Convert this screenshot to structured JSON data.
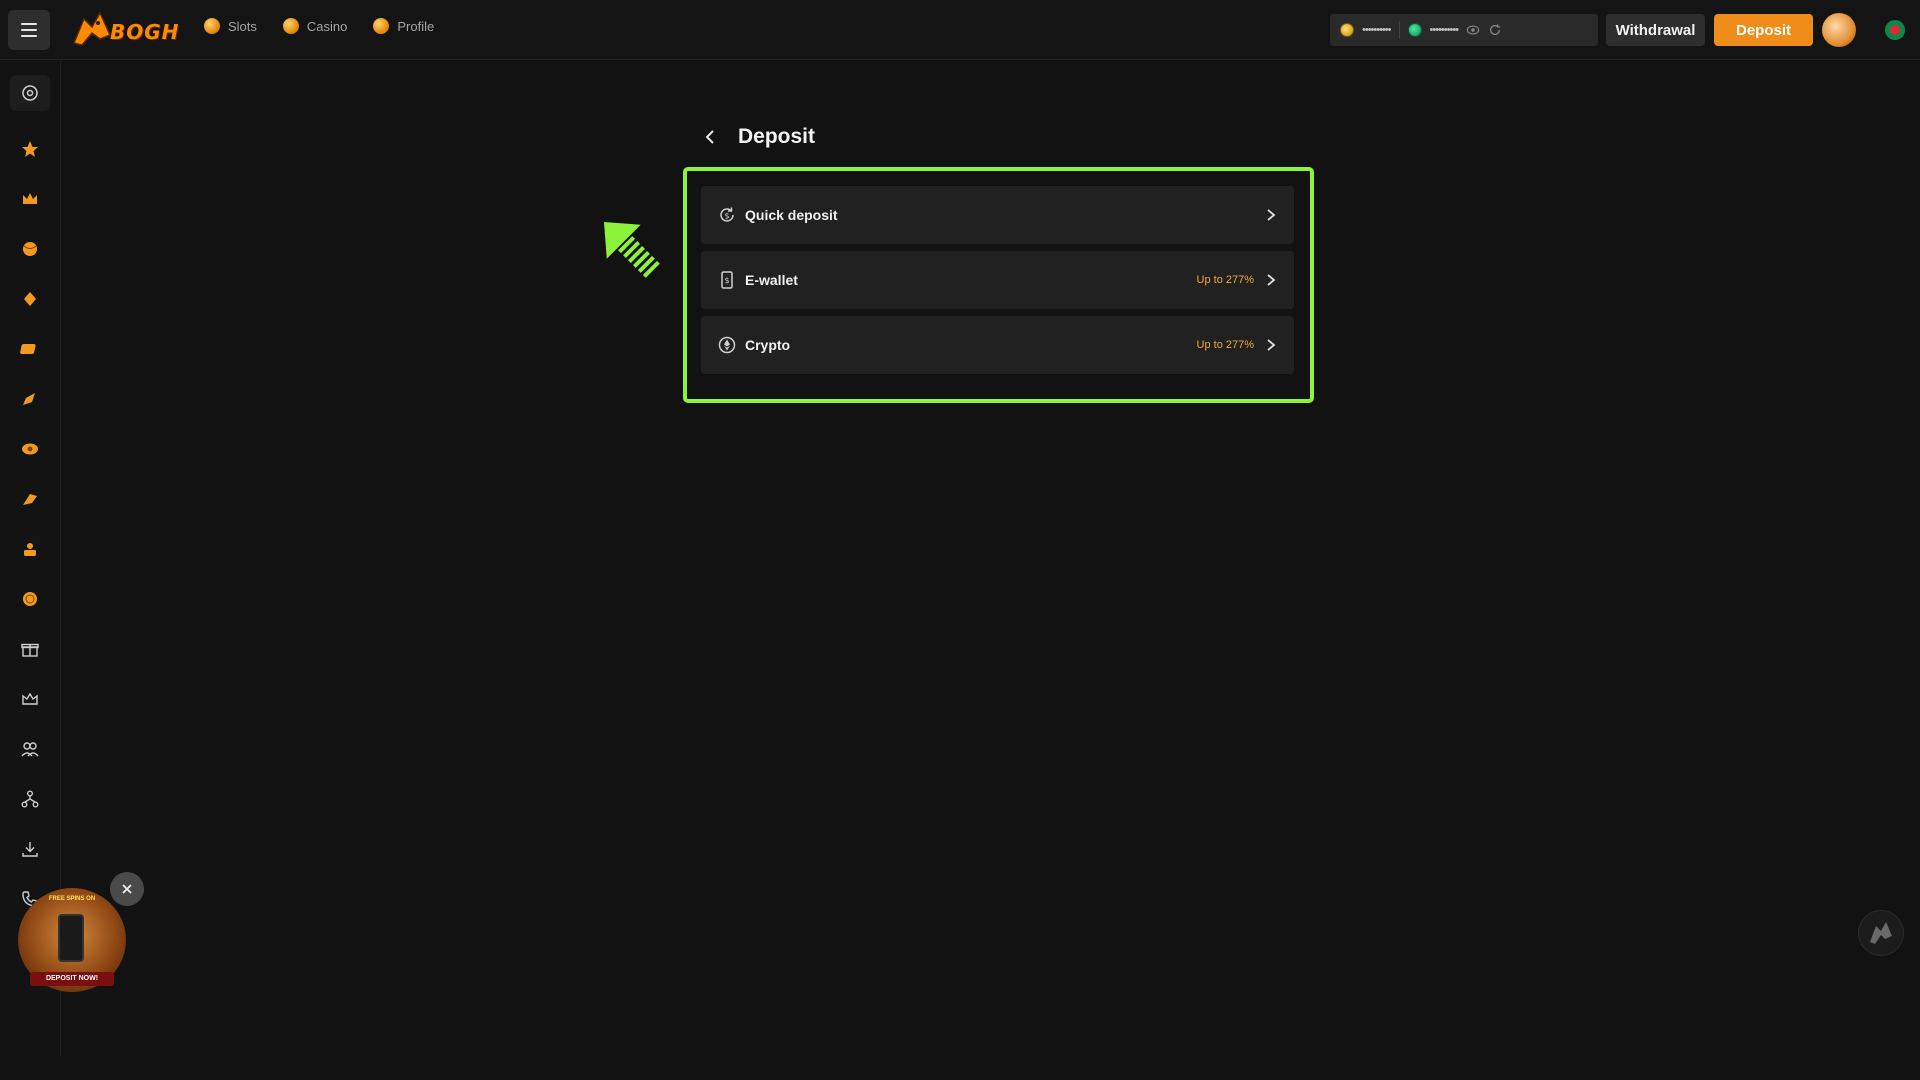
{
  "header": {
    "logo_text": "BOGH",
    "nav": [
      {
        "label": "Slots",
        "icon": "slots-icon"
      },
      {
        "label": "Casino",
        "icon": "casino-icon"
      },
      {
        "label": "Profile",
        "icon": "profile-icon"
      }
    ],
    "balances": {
      "main": "••••••••••",
      "bonus": "••••••••••"
    },
    "withdraw_label": "Withdrawal",
    "deposit_label": "Deposit"
  },
  "sidebar": {
    "items": [
      "support-icon",
      "hot-icon",
      "crown-icon",
      "sports-ball-icon",
      "poker-icon",
      "slots-icon",
      "rocket-icon",
      "lottery-icon",
      "fishing-icon",
      "arcade-icon",
      "coin-icon",
      "gift-icon",
      "vip-icon",
      "referral-icon",
      "network-icon",
      "download-icon",
      "phone-icon"
    ]
  },
  "main": {
    "title": "Deposit",
    "options": [
      {
        "label": "Quick deposit",
        "bonus": "",
        "icon": "quick-deposit-icon"
      },
      {
        "label": "E-wallet",
        "bonus": "Up to 277%",
        "icon": "e-wallet-icon"
      },
      {
        "label": "Crypto",
        "bonus": "Up to 277%",
        "icon": "crypto-icon"
      }
    ]
  },
  "promo": {
    "top_text": "FREE SPINS ON",
    "cta": "DEPOSIT NOW!"
  },
  "colors": {
    "accent": "#f08c1a",
    "highlight": "#8cf23a",
    "background": "#121212"
  }
}
